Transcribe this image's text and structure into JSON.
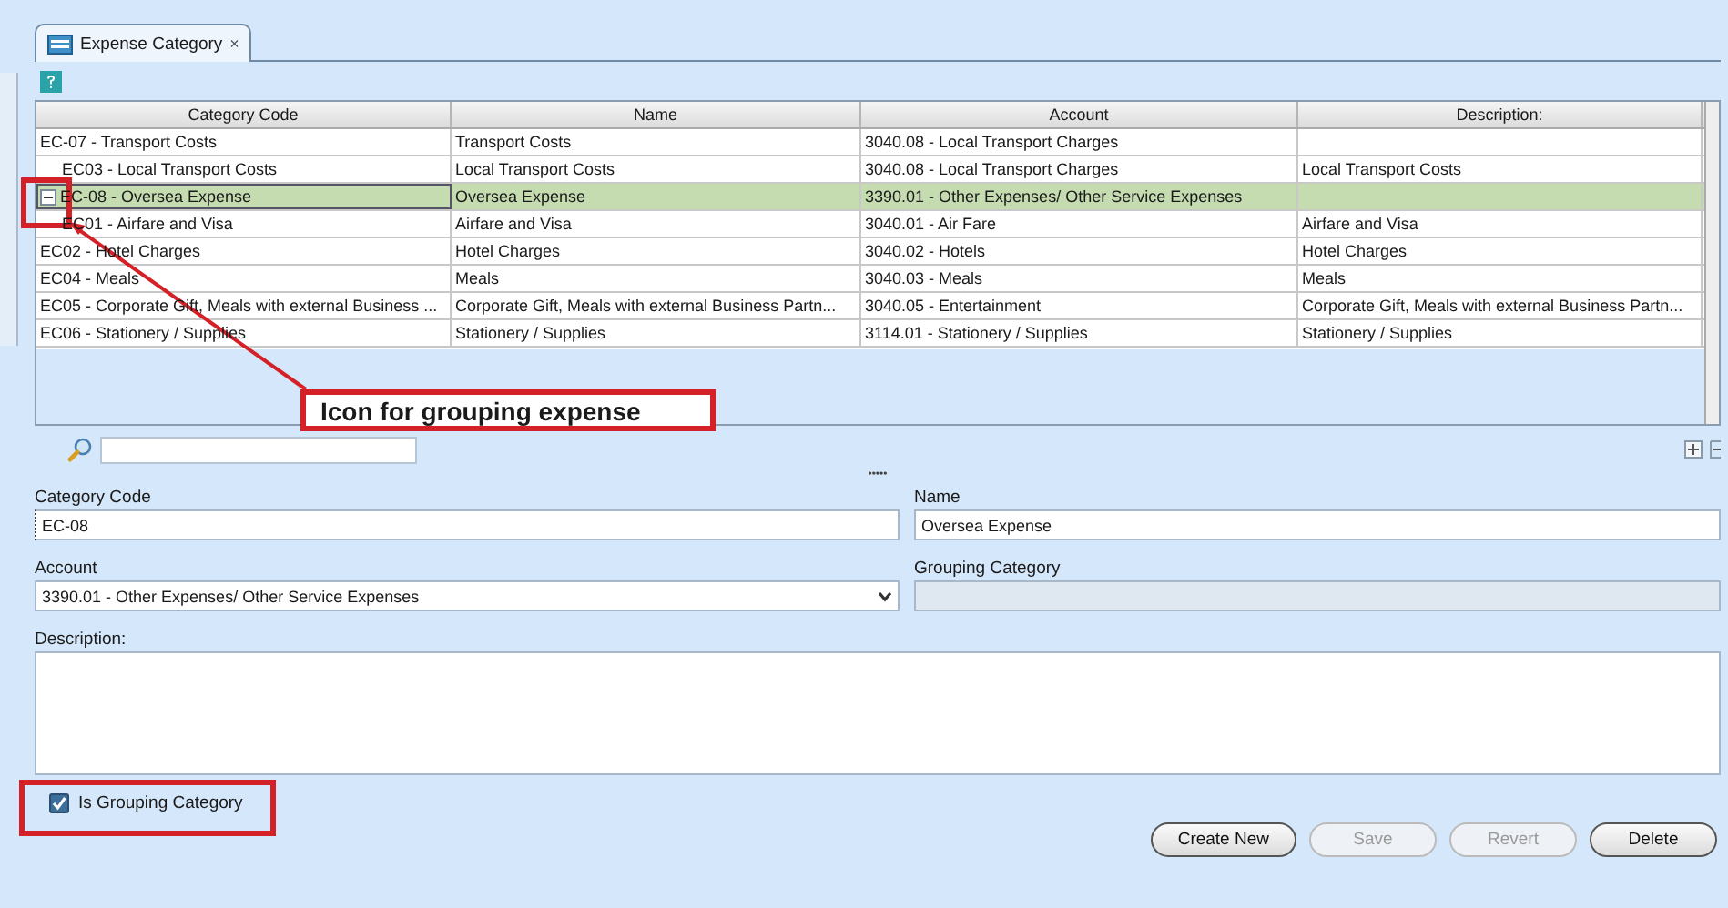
{
  "tab": {
    "title": "Expense Category",
    "close": "×"
  },
  "table": {
    "columns": [
      "Category Code",
      "Name",
      "Account",
      "Description:"
    ],
    "rows": [
      {
        "cells": [
          "EC-07 - Transport Costs",
          "Transport Costs",
          "3040.08 - Local Transport Charges",
          ""
        ],
        "selected": false,
        "children": [
          {
            "cells": [
              "EC03 - Local Transport Costs",
              "Local Transport Costs",
              "3040.08 - Local Transport Charges",
              "Local Transport Costs"
            ],
            "selected": false
          }
        ]
      },
      {
        "cells": [
          "EC-08 - Oversea Expense",
          "Oversea Expense",
          "3390.01 - Other Expenses/ Other Service Expenses",
          ""
        ],
        "selected": true,
        "expanded": true,
        "children": [
          {
            "cells": [
              "EC01 - Airfare and Visa",
              "Airfare and Visa",
              "3040.01 - Air Fare",
              "Airfare and Visa"
            ],
            "selected": false
          }
        ]
      },
      {
        "cells": [
          "EC02 - Hotel Charges",
          "Hotel Charges",
          "3040.02 - Hotels",
          "Hotel Charges"
        ],
        "selected": false
      },
      {
        "cells": [
          "EC04 - Meals",
          "Meals",
          "3040.03 - Meals",
          "Meals"
        ],
        "selected": false
      },
      {
        "cells": [
          "EC05 - Corporate Gift, Meals with external Business ...",
          "Corporate Gift, Meals with external Business Partn...",
          "3040.05 - Entertainment",
          "Corporate Gift, Meals with external Business Partn..."
        ],
        "selected": false
      },
      {
        "cells": [
          "EC06 - Stationery / Supplies",
          "Stationery / Supplies",
          "3114.01 - Stationery / Supplies",
          "Stationery / Supplies"
        ],
        "selected": false
      }
    ]
  },
  "annotations": [
    {
      "text": "Icon for grouping expense"
    }
  ],
  "form": {
    "splitter": "•••••",
    "category_code": {
      "label": "Category Code",
      "value": "EC-08"
    },
    "name": {
      "label": "Name",
      "value": "Oversea Expense"
    },
    "account": {
      "label": "Account",
      "value": "3390.01 - Other Expenses/ Other Service Expenses"
    },
    "grouping_category": {
      "label": "Grouping Category",
      "disabled": true
    },
    "description": {
      "label": "Description:"
    },
    "is_grouping": {
      "label": "Is Grouping Category",
      "checked": true
    }
  },
  "buttons": [
    {
      "label": "Create New",
      "disabled": false
    },
    {
      "label": "Save",
      "disabled": true
    },
    {
      "label": "Revert",
      "disabled": true
    },
    {
      "label": "Delete",
      "disabled": false
    }
  ]
}
